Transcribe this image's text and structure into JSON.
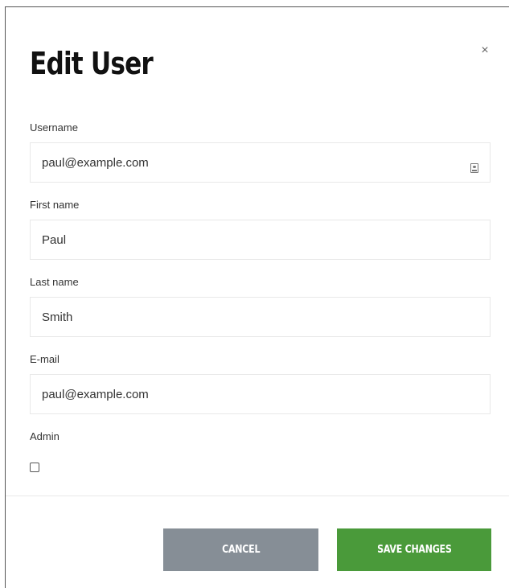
{
  "modal": {
    "title": "Edit User",
    "close_symbol": "×"
  },
  "form": {
    "username": {
      "label": "Username",
      "value": "paul@example.com",
      "icon": "contact-card-icon"
    },
    "first_name": {
      "label": "First name",
      "value": "Paul"
    },
    "last_name": {
      "label": "Last name",
      "value": "Smith"
    },
    "email": {
      "label": "E-mail",
      "value": "paul@example.com"
    },
    "admin": {
      "label": "Admin",
      "checked": false
    }
  },
  "footer": {
    "cancel_label": "CANCEL",
    "save_label": "SAVE CHANGES"
  },
  "colors": {
    "cancel_button": "#868e96",
    "save_button": "#4a9a3a"
  }
}
